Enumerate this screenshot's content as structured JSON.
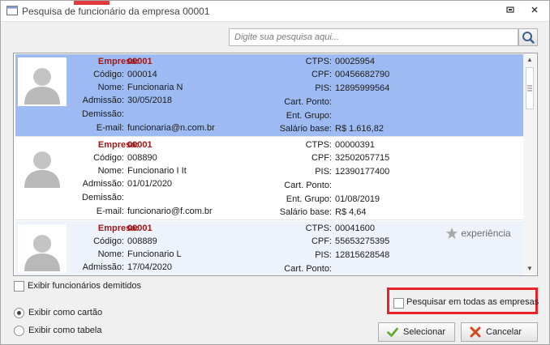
{
  "window": {
    "title": "Pesquisa de funcionário da empresa 00001"
  },
  "search": {
    "placeholder": "Digite sua pesquisa aqui..."
  },
  "labels": {
    "empresa": "Empresa:",
    "codigo": "Código:",
    "nome": "Nome:",
    "admissao": "Admissão:",
    "demissao": "Demissão:",
    "email": "E-mail:",
    "ctps": "CTPS:",
    "cpf": "CPF:",
    "pis": "PIS:",
    "cart_ponto": "Cart. Ponto:",
    "ent_grupo": "Ent. Grupo:",
    "salario": "Salário base:"
  },
  "employees": [
    {
      "empresa": "00001",
      "codigo": "000014",
      "nome": "Funcionaria N",
      "admissao": "30/05/2018",
      "demissao": "",
      "email": "funcionaria@n.com.br",
      "ctps": "00025954",
      "cpf": "00456682790",
      "pis": "12895999564",
      "cart_ponto": "",
      "ent_grupo": "",
      "salario": "R$ 1.616,82"
    },
    {
      "empresa": "00001",
      "codigo": "008890",
      "nome": "Funcionario I It",
      "admissao": "01/01/2020",
      "demissao": "",
      "email": "funcionario@f.com.br",
      "ctps": "00000391",
      "cpf": "32502057715",
      "pis": "12390177400",
      "cart_ponto": "",
      "ent_grupo": "01/08/2019",
      "salario": "R$ 4,64"
    },
    {
      "empresa": "00001",
      "codigo": "008889",
      "nome": "Funcionario L",
      "admissao": "17/04/2020",
      "demissao": "",
      "email": "",
      "ctps": "00041600",
      "cpf": "55653275395",
      "pis": "12815628548",
      "cart_ponto": "",
      "ent_grupo": "",
      "salario": "",
      "badge": "experiência"
    }
  ],
  "options": {
    "show_dismissed": "Exibir funcionários demitidos",
    "search_all": "Pesquisar em todas as empresas",
    "view_card": "Exibir como cartão",
    "view_table": "Exibir como tabela"
  },
  "buttons": {
    "select": "Selecionar",
    "cancel": "Cancelar"
  },
  "colors": {
    "selected_row": "#9dbbf2",
    "company_text": "#a01818",
    "highlight": "#e8222b"
  },
  "icons": {
    "search": "magnifier-icon",
    "confirm": "check-icon",
    "cancel": "x-icon",
    "badge": "star-icon"
  }
}
